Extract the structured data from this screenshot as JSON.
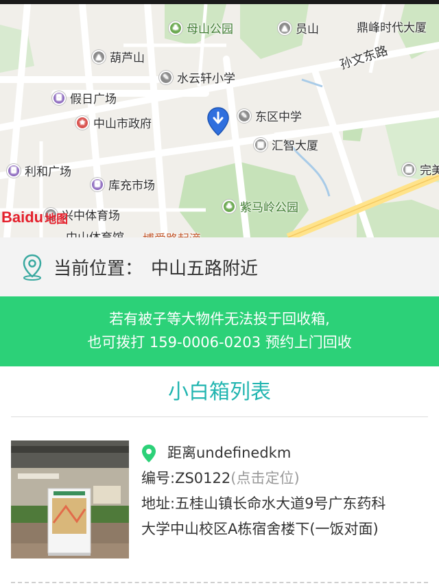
{
  "map": {
    "logo_text": "Baidu",
    "logo_ditu": "地图",
    "roads": [
      "孙文东路"
    ],
    "pois": [
      {
        "id": "mushan-park",
        "label": "母山公园",
        "type": "park"
      },
      {
        "id": "yuanshan",
        "label": "员山",
        "type": "mountain"
      },
      {
        "id": "dingfeng",
        "label": "鼎峰时代大厦",
        "type": "text"
      },
      {
        "id": "huludashan",
        "label": "葫芦山",
        "type": "mountain"
      },
      {
        "id": "shuiyunxuan",
        "label": "水云轩小学",
        "type": "school"
      },
      {
        "id": "jiari",
        "label": "假日广场",
        "type": "shop"
      },
      {
        "id": "gov",
        "label": "中山市政府",
        "type": "gov"
      },
      {
        "id": "dongqu",
        "label": "东区中学",
        "type": "school"
      },
      {
        "id": "huizhi",
        "label": "汇智大厦",
        "type": "bldg"
      },
      {
        "id": "lihe",
        "label": "利和广场",
        "type": "shop"
      },
      {
        "id": "kuchong",
        "label": "库充市场",
        "type": "shop"
      },
      {
        "id": "wan",
        "label": "完美",
        "type": "bldg"
      },
      {
        "id": "zimaling",
        "label": "紫马岭公园",
        "type": "park"
      },
      {
        "id": "xingzhong",
        "label": "兴中体育场",
        "type": "school"
      },
      {
        "id": "tiyuguan",
        "label": "中山体育馆",
        "type": "text"
      },
      {
        "id": "bolan",
        "label": "博爱路起滴",
        "type": "text"
      }
    ]
  },
  "location": {
    "label": "当前位置：",
    "value": "中山五路附近"
  },
  "notice": {
    "line1": "若有被子等大物件无法投于回收箱,",
    "line2": "也可拨打 159-0006-0203 预约上门回收"
  },
  "list": {
    "title": "小白箱列表",
    "items": [
      {
        "distance": "距离undefinedkm",
        "code_label": "编号:ZS0122",
        "code_hint": "(点击定位)",
        "address_line1": "地址:五桂山镇长命水大道9号广东药科",
        "address_line2": "大学中山校区A栋宿舍楼下(一饭对面)"
      }
    ]
  },
  "colors": {
    "accent_green": "#2cd178",
    "title_teal": "#22b5b0",
    "pin_teal": "#3aa9a0",
    "marker_blue": "#2f6fde",
    "logo_red": "#e4202c"
  }
}
